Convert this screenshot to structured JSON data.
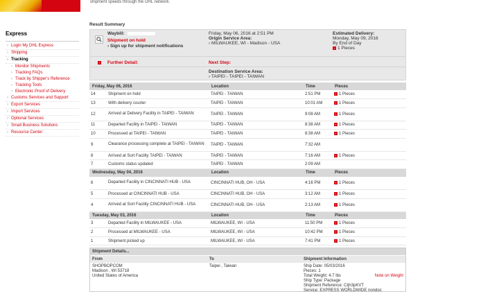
{
  "page": {
    "intro_text": "shipment speeds through the DHL network."
  },
  "sidebar": {
    "title": "Express",
    "items": [
      {
        "label": "Login My DHL Express"
      },
      {
        "label": "Shipping"
      },
      {
        "label": "Tracking"
      },
      {
        "label": "Monitor Shipments"
      },
      {
        "label": "Tracking FAQs"
      },
      {
        "label": "Track by Shipper's Reference"
      },
      {
        "label": "Tracking Tools"
      },
      {
        "label": "Electronic Proof of Delivery"
      },
      {
        "label": "Customs Services and Support"
      },
      {
        "label": "Export Services"
      },
      {
        "label": "Import Services"
      },
      {
        "label": "Optional Services"
      },
      {
        "label": "Small Business Solutions"
      },
      {
        "label": "Resource Center"
      }
    ]
  },
  "summary": {
    "title": "Result Summary",
    "waybill_label": "Waybill:",
    "status": "Shipment on hold",
    "signup": "Sign up for shipment notifications",
    "date_time": "Friday, May 06, 2016 at 2:51 PM",
    "origin_label": "Origin Service Area:",
    "origin": "MILWAUKEE, WI - Madison - USA",
    "est_label": "Estimated Delivery:",
    "est_date": "Monday, May 09, 2016",
    "est_time": "By End of Day",
    "pieces": "1 Pieces",
    "further_label": "Further Detail:",
    "next_label": "Next Step:",
    "dest_label": "Destination Service Area:",
    "dest": "TAIPEI - TAIPEI - TAIWAN"
  },
  "table": {
    "col_location": "Location",
    "col_time": "Time",
    "col_pieces": "Pieces",
    "groups": [
      {
        "date": "Friday, May 06, 2016",
        "rows": [
          {
            "num": "14",
            "desc": "Shipment on hold",
            "loc": "TAIPEI - TAIWAN",
            "time": "2:51 PM",
            "pieces": "1 Pieces"
          },
          {
            "num": "13",
            "desc": "With delivery courier",
            "loc": "TAIPEI - TAIWAN",
            "time": "10:01 AM",
            "pieces": "1 Pieces"
          },
          {
            "num": "12",
            "desc": "Arrived at Delivery Facility in TAIPEI - TAIWAN",
            "loc": "TAIPEI - TAIWAN",
            "time": "9:08 AM",
            "pieces": "1 Pieces"
          },
          {
            "num": "11",
            "desc": "Departed Facility in TAIPEI - TAIWAN",
            "loc": "TAIPEI - TAIWAN",
            "time": "8:38 AM",
            "pieces": "1 Pieces"
          },
          {
            "num": "10",
            "desc": "Processed at TAIPEI - TAIWAN",
            "loc": "TAIPEI - TAIWAN",
            "time": "8:38 AM",
            "pieces": "1 Pieces"
          },
          {
            "num": "9",
            "desc": "Clearance processing complete at TAIPEI - TAIWAN",
            "loc": "TAIPEI - TAIWAN",
            "time": "7:32 AM",
            "pieces": ""
          },
          {
            "num": "8",
            "desc": "Arrived at Sort Facility TAIPEI - TAIWAN",
            "loc": "TAIPEI - TAIWAN",
            "time": "7:16 AM",
            "pieces": "1 Pieces"
          },
          {
            "num": "7",
            "desc": "Customs status updated",
            "loc": "TAIPEI - TAIWAN",
            "time": "2:09 AM",
            "pieces": ""
          }
        ]
      },
      {
        "date": "Wednesday, May 04, 2016",
        "rows": [
          {
            "num": "6",
            "desc": "Departed Facility in CINCINNATI HUB - USA",
            "loc": "CINCINNATI HUB, OH - USA",
            "time": "4:16 PM",
            "pieces": "1 Pieces"
          },
          {
            "num": "5",
            "desc": "Processed at CINCINNATI HUB - USA",
            "loc": "CINCINNATI HUB, OH - USA",
            "time": "3:12 AM",
            "pieces": "1 Pieces"
          },
          {
            "num": "4",
            "desc": "Arrived at Sort Facility CINCINNATI HUB - USA",
            "loc": "CINCINNATI HUB, OH - USA",
            "time": "2:13 AM",
            "pieces": "1 Pieces"
          }
        ]
      },
      {
        "date": "Tuesday, May 03, 2016",
        "rows": [
          {
            "num": "3",
            "desc": "Departed Facility in MILWAUKEE - USA",
            "loc": "MILWAUKEE, WI - USA",
            "time": "11:50 PM",
            "pieces": "1 Pieces"
          },
          {
            "num": "2",
            "desc": "Processed at MILWAUKEE - USA",
            "loc": "MILWAUKEE, WI - USA",
            "time": "10:42 PM",
            "pieces": "1 Pieces"
          },
          {
            "num": "1",
            "desc": "Shipment picked up",
            "loc": "MILWAUKEE, WI - USA",
            "time": "7:41 PM",
            "pieces": "1 Pieces"
          }
        ]
      }
    ]
  },
  "details": {
    "title": "Shipment Details...",
    "col_from": "From",
    "col_to": "To",
    "col_info": "Shipment Information",
    "from_1": "SHOPBOPCOM",
    "from_2": "Madison , WI 53718",
    "from_3": "United States of America",
    "to_1": "Taipei , Taiwan",
    "ship_date": "Ship Date: 05/03/2016",
    "pieces": "Pieces: 1",
    "weight": "Total Weight: 4.7 lbs",
    "note": "Note on Weight",
    "ship_type": "Ship Type: Package",
    "reference": "Shipment Reference: CIjh3pKVT",
    "service": "Service: EXPRESS WORLDWIDE nondoc"
  }
}
